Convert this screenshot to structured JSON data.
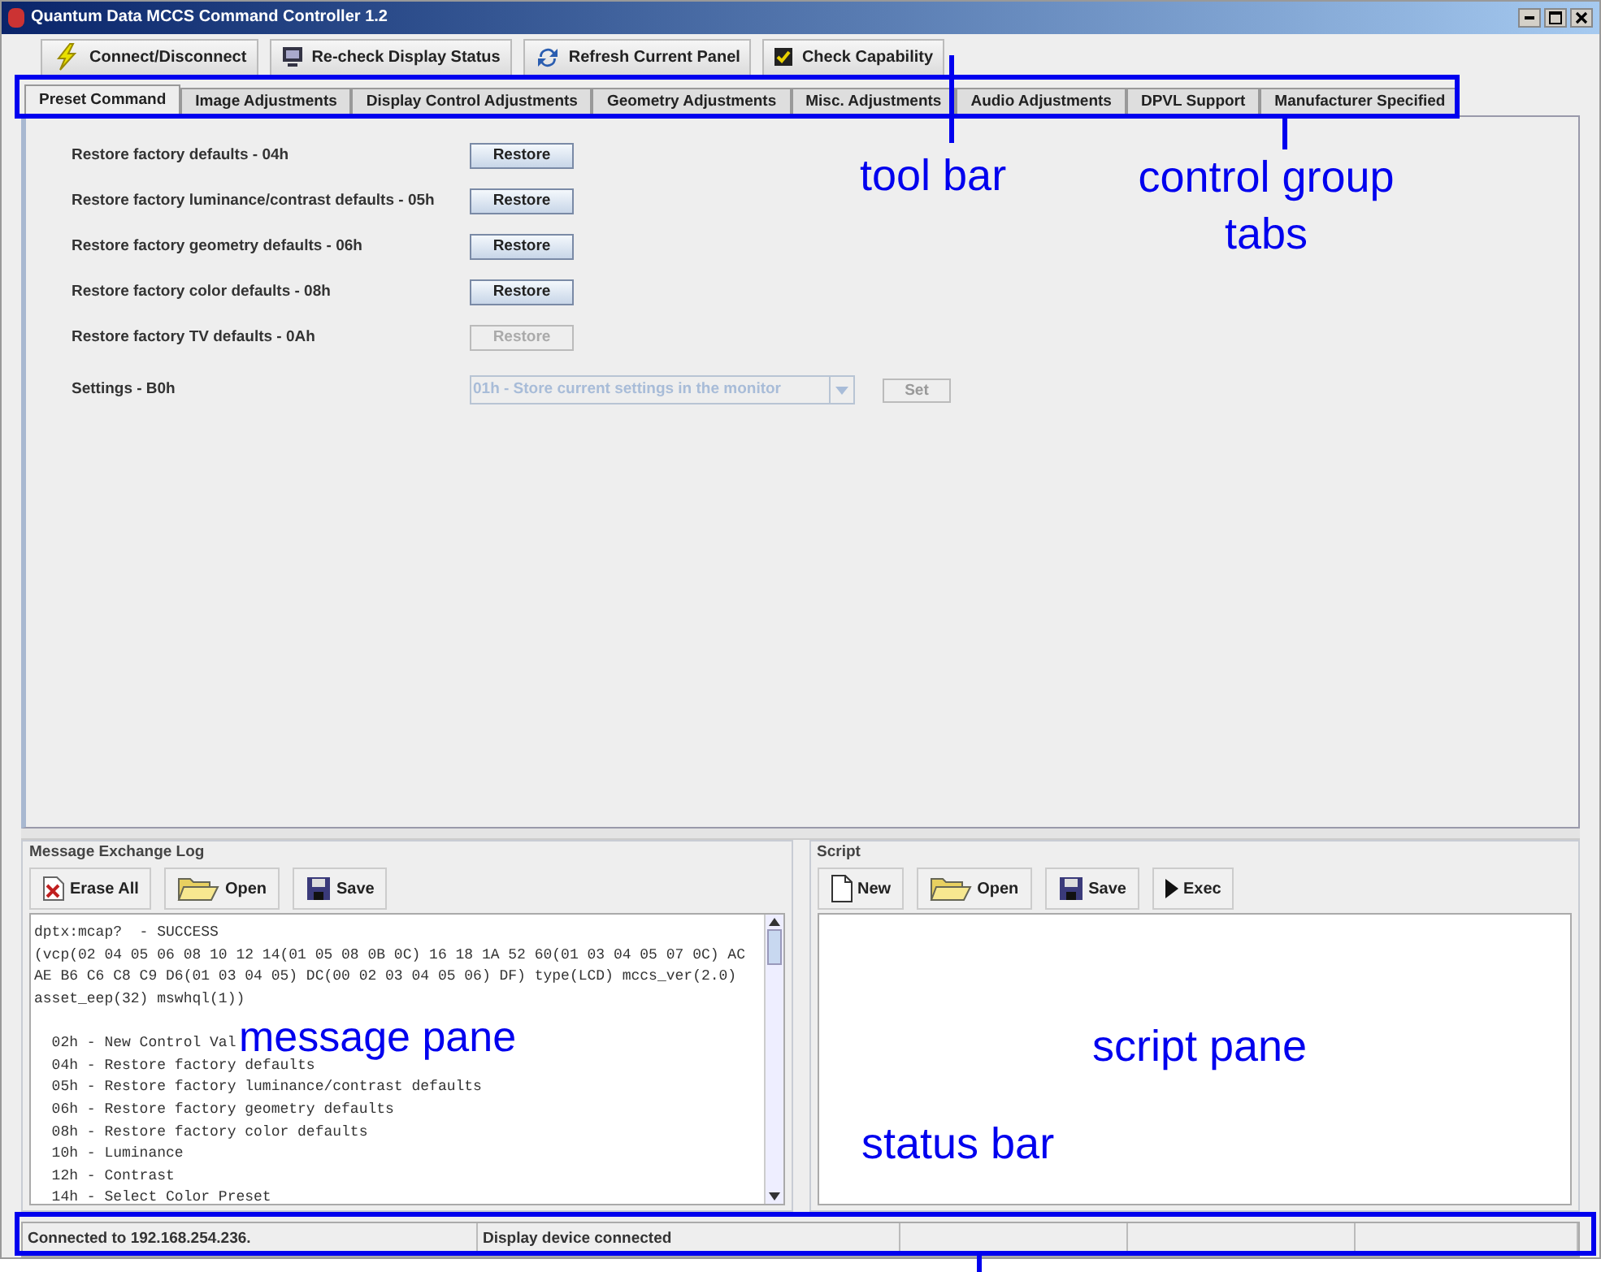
{
  "window": {
    "title": "Quantum Data MCCS Command Controller 1.2"
  },
  "toolbar": [
    {
      "label": "Connect/Disconnect",
      "kind": "bolt"
    },
    {
      "label": "Re-check Display Status",
      "kind": "monitor"
    },
    {
      "label": "Refresh Current Panel",
      "kind": "refresh"
    },
    {
      "label": "Check Capability",
      "kind": "check"
    }
  ],
  "tabs": [
    {
      "label": "Preset Command",
      "selected": true
    },
    {
      "label": "Image Adjustments",
      "selected": false
    },
    {
      "label": "Display Control Adjustments",
      "selected": false
    },
    {
      "label": "Geometry Adjustments",
      "selected": false
    },
    {
      "label": "Misc. Adjustments",
      "selected": false
    },
    {
      "label": "Audio Adjustments",
      "selected": false
    },
    {
      "label": "DPVL Support",
      "selected": false
    },
    {
      "label": "Manufacturer Specified",
      "selected": false
    }
  ],
  "preset_rows": [
    {
      "label": "Restore factory defaults - 04h",
      "button": "Restore",
      "disabled": false
    },
    {
      "label": "Restore factory luminance/contrast defaults - 05h",
      "button": "Restore",
      "disabled": false
    },
    {
      "label": "Restore factory geometry defaults - 06h",
      "button": "Restore",
      "disabled": false
    },
    {
      "label": "Restore factory color defaults - 08h",
      "button": "Restore",
      "disabled": false
    },
    {
      "label": "Restore factory TV defaults - 0Ah",
      "button": "Restore",
      "disabled": true
    }
  ],
  "settings": {
    "label": "Settings - B0h",
    "value": "01h - Store current settings in the monitor",
    "button": "Set",
    "disabled": true
  },
  "message_log": {
    "title": "Message Exchange Log",
    "buttons": [
      {
        "label": "Erase All",
        "kind": "erase"
      },
      {
        "label": "Open",
        "kind": "open"
      },
      {
        "label": "Save",
        "kind": "save"
      }
    ],
    "lines": [
      "dptx:mcap?  - SUCCESS",
      "(vcp(02 04 05 06 08 10 12 14(01 05 08 0B 0C) 16 18 1A 52 60(01 03 04 05 07 0C) AC",
      "AE B6 C6 C8 C9 D6(01 03 04 05) DC(00 02 03 04 05 06) DF) type(LCD) mccs_ver(2.0)",
      "asset_eep(32) mswhql(1))",
      "  02h - New Control Val",
      "  04h - Restore factory defaults",
      "  05h - Restore factory luminance/contrast defaults",
      "  06h - Restore factory geometry defaults",
      "  08h - Restore factory color defaults",
      "  10h - Luminance",
      "  12h - Contrast",
      "  14h - Select Color Preset"
    ]
  },
  "script": {
    "title": "Script",
    "buttons": [
      {
        "label": "New",
        "kind": "new"
      },
      {
        "label": "Open",
        "kind": "open"
      },
      {
        "label": "Save",
        "kind": "save"
      },
      {
        "label": "Exec",
        "kind": "exec"
      }
    ]
  },
  "status_bar": [
    "Connected to 192.168.254.236.",
    "Display device connected"
  ],
  "annotations": [
    {
      "text": "tool bar",
      "kind": "toolbar"
    },
    {
      "text": "control group tabs",
      "kind": "tabs"
    },
    {
      "text": "message pane",
      "kind": "message"
    },
    {
      "text": "script pane",
      "kind": "script"
    },
    {
      "text": "status bar",
      "kind": "status"
    }
  ]
}
